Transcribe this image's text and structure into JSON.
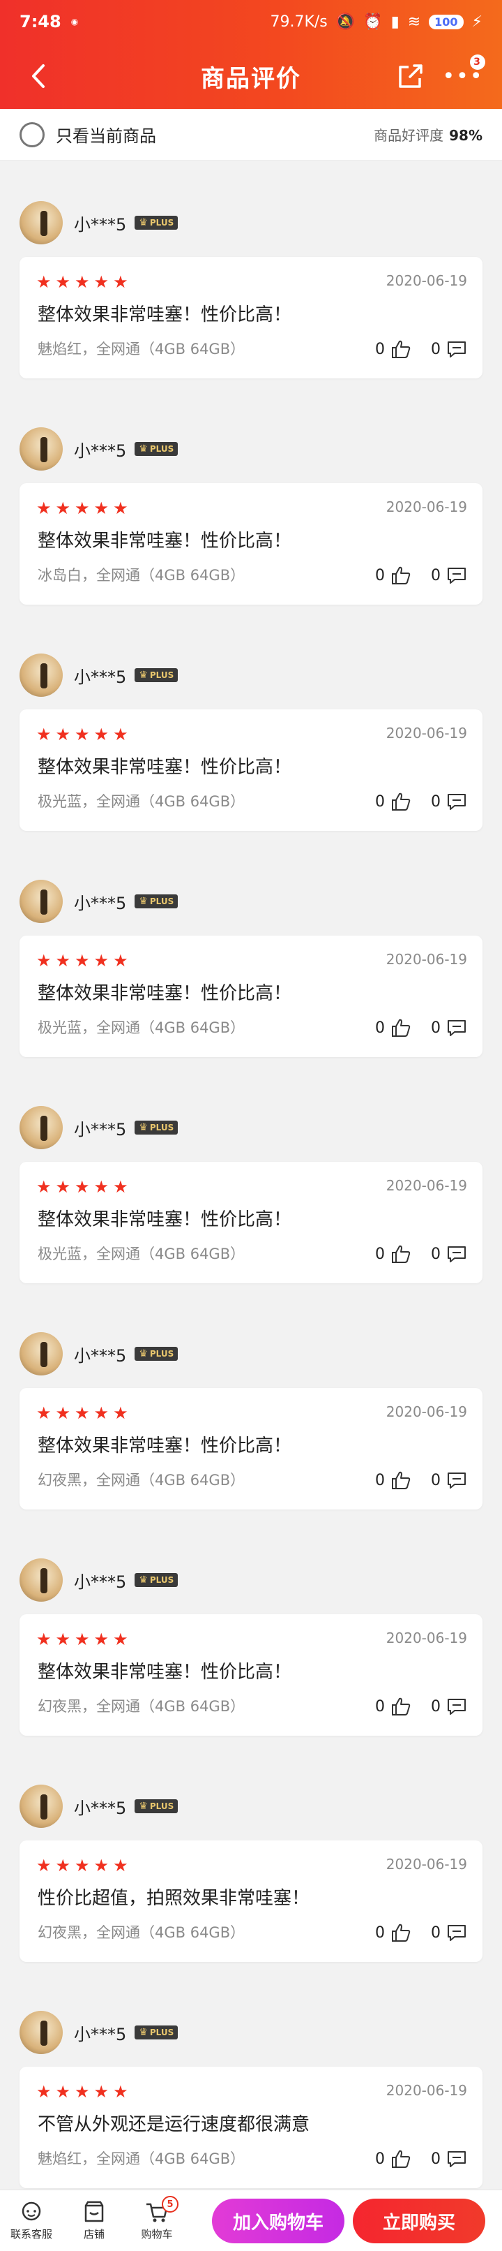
{
  "status_bar": {
    "time": "7:48",
    "network_speed": "79.7K/s",
    "battery": "100"
  },
  "nav": {
    "title": "商品评价",
    "more_badge": "3"
  },
  "filter": {
    "label": "只看当前商品",
    "good_rate_label": "商品好评度",
    "good_rate_value": "98%"
  },
  "plus_label": "PLUS",
  "reviews": [
    {
      "user": "小***5",
      "rating": 5,
      "date": "2020-06-19",
      "content": "整体效果非常哇塞！性价比高！",
      "spec": "魅焰红，全网通（4GB 64GB）",
      "likes": "0",
      "comments": "0"
    },
    {
      "user": "小***5",
      "rating": 5,
      "date": "2020-06-19",
      "content": "整体效果非常哇塞！性价比高！",
      "spec": "冰岛白，全网通（4GB 64GB）",
      "likes": "0",
      "comments": "0"
    },
    {
      "user": "小***5",
      "rating": 5,
      "date": "2020-06-19",
      "content": "整体效果非常哇塞！性价比高！",
      "spec": "极光蓝，全网通（4GB 64GB）",
      "likes": "0",
      "comments": "0"
    },
    {
      "user": "小***5",
      "rating": 5,
      "date": "2020-06-19",
      "content": "整体效果非常哇塞！性价比高！",
      "spec": "极光蓝，全网通（4GB 64GB）",
      "likes": "0",
      "comments": "0"
    },
    {
      "user": "小***5",
      "rating": 5,
      "date": "2020-06-19",
      "content": "整体效果非常哇塞！性价比高！",
      "spec": "极光蓝，全网通（4GB 64GB）",
      "likes": "0",
      "comments": "0"
    },
    {
      "user": "小***5",
      "rating": 5,
      "date": "2020-06-19",
      "content": "整体效果非常哇塞！性价比高！",
      "spec": "幻夜黑，全网通（4GB 64GB）",
      "likes": "0",
      "comments": "0"
    },
    {
      "user": "小***5",
      "rating": 5,
      "date": "2020-06-19",
      "content": "整体效果非常哇塞！性价比高！",
      "spec": "幻夜黑，全网通（4GB 64GB）",
      "likes": "0",
      "comments": "0"
    },
    {
      "user": "小***5",
      "rating": 5,
      "date": "2020-06-19",
      "content": "性价比超值，拍照效果非常哇塞！",
      "spec": "幻夜黑，全网通（4GB 64GB）",
      "likes": "0",
      "comments": "0"
    },
    {
      "user": "小***5",
      "rating": 5,
      "date": "2020-06-19",
      "content": "不管从外观还是运行速度都很满意",
      "spec": "魅焰红，全网通（4GB 64GB）",
      "likes": "0",
      "comments": "0"
    }
  ],
  "bottom_bar": {
    "service_label": "联系客服",
    "store_label": "店铺",
    "cart_label": "购物车",
    "cart_count": "5",
    "add_to_cart": "加入购物车",
    "buy_now": "立即购买"
  },
  "colors": {
    "header_start": "#f0302a",
    "header_end": "#f46a1c",
    "star": "#f0301f",
    "add_btn": "#d033dd",
    "buy_btn": "#f5262f"
  }
}
